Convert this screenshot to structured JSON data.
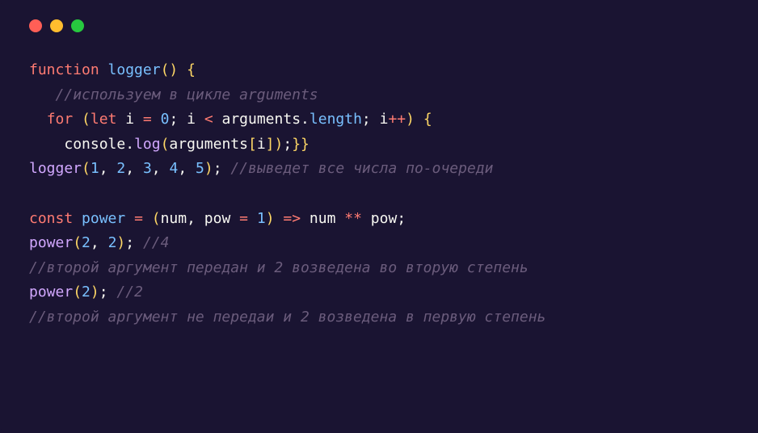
{
  "titlebar": {
    "dots": [
      "red",
      "yellow",
      "green"
    ]
  },
  "code": {
    "line1": {
      "kw1": "function",
      "fn": "logger",
      "paren_open": "(",
      "paren_close": ")",
      "brace_open": " {"
    },
    "line2": {
      "indent": "   ",
      "comment": "//используем в цикле arguments"
    },
    "line3": {
      "indent": "  ",
      "kw_for": "for",
      "paren_open": " (",
      "kw_let": "let",
      "var_i": " i ",
      "op_eq": "=",
      "num_0": " 0",
      "semi1": ";",
      "var_i2": " i ",
      "op_lt": "<",
      "sp1": " ",
      "arguments1": "arguments",
      "dot1": ".",
      "length": "length",
      "semi2": ";",
      "sp2": " ",
      "var_i3": "i",
      "op_inc": "++",
      "paren_close": ")",
      "brace_open": " {"
    },
    "line4": {
      "indent": "    ",
      "console": "console",
      "dot": ".",
      "log": "log",
      "paren_open": "(",
      "arguments": "arguments",
      "bracket_open": "[",
      "var_i": "i",
      "bracket_close": "]",
      "paren_close": ")",
      "semi": ";",
      "brace1": "}",
      "brace2": "}"
    },
    "line5": {
      "fn": "logger",
      "paren_open": "(",
      "n1": "1",
      "c1": ", ",
      "n2": "2",
      "c2": ", ",
      "n3": "3",
      "c3": ", ",
      "n4": "4",
      "c4": ", ",
      "n5": "5",
      "paren_close": ")",
      "semi": ";",
      "sp": " ",
      "comment": "//выведет все числа по-очереди"
    },
    "line7": {
      "kw_const": "const",
      "sp1": " ",
      "name": "power",
      "sp2": " ",
      "op_eq": "=",
      "sp3": " ",
      "paren_open": "(",
      "num_param": "num",
      "comma": ", ",
      "pow_param": "pow",
      "sp4": " ",
      "op_eq2": "=",
      "sp5": " ",
      "num_1": "1",
      "paren_close": ")",
      "sp6": " ",
      "arrow": "=>",
      "sp7": " ",
      "num_ref": "num",
      "sp8": " ",
      "op_pow": "**",
      "sp9": " ",
      "pow_ref": "pow",
      "semi": ";"
    },
    "line8": {
      "fn": "power",
      "paren_open": "(",
      "n1": "2",
      "comma": ", ",
      "n2": "2",
      "paren_close": ")",
      "semi": ";",
      "sp": " ",
      "comment": "//4"
    },
    "line9": {
      "comment": "//второй аргумент передан и 2 возведена во вторую степень"
    },
    "line10": {
      "fn": "power",
      "paren_open": "(",
      "n1": "2",
      "paren_close": ")",
      "semi": ";",
      "sp": " ",
      "comment": "//2"
    },
    "line11": {
      "comment": "//второй аргумент не передаи и 2 возведена в первую степень"
    }
  }
}
